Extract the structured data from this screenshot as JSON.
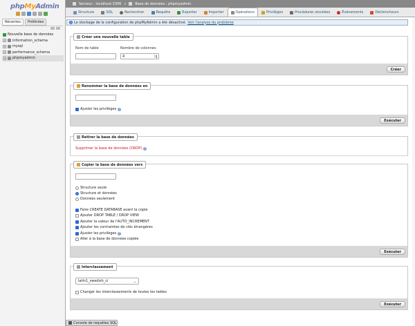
{
  "nav": {
    "logo_php": "php",
    "logo_my": "My",
    "logo_admin": "Admin",
    "tabs": [
      "Récentes",
      "Préférées"
    ],
    "tree": [
      {
        "label": "Nouvelle base de données",
        "icon": "new-db-icon"
      },
      {
        "label": "information_schema",
        "icon": "database-icon"
      },
      {
        "label": "mysql",
        "icon": "database-icon"
      },
      {
        "label": "performance_schema",
        "icon": "database-icon"
      },
      {
        "label": "phpmyadmin",
        "icon": "database-icon"
      }
    ]
  },
  "breadcrumb": {
    "server": "Serveur : localhost:3306",
    "database": "Base de données : phpmyadmin"
  },
  "tabs": [
    {
      "label": "Structure",
      "color": "#6d8fc7"
    },
    {
      "label": "SQL",
      "color": "#7b7b7b"
    },
    {
      "label": "Rechercher",
      "color": "#666"
    },
    {
      "label": "Requête",
      "color": "#4f7bb6"
    },
    {
      "label": "Exporter",
      "color": "#3c8d4e"
    },
    {
      "label": "Importer",
      "color": "#d7822b"
    },
    {
      "label": "Opérations",
      "color": "#8a8a8a"
    },
    {
      "label": "Privilèges",
      "color": "#c9a32a"
    },
    {
      "label": "Procédures stockées",
      "color": "#6c6c6c"
    },
    {
      "label": "Événements",
      "color": "#c62d2d"
    },
    {
      "label": "Déclencheurs",
      "color": "#d44a2c"
    }
  ],
  "notice": {
    "text": "Le stockage de la configuration de phpMyAdmin a été désactivé.",
    "link": "Voir l'analyse du problème"
  },
  "create_table": {
    "legend": "Créer une nouvelle table",
    "name_label": "Nom de table",
    "columns_label": "Nombre de colonnes",
    "columns_value": "4",
    "button": "Créer"
  },
  "rename_db": {
    "legend": "Renommer la base de données en",
    "privileges_label": "Ajuster les privilèges",
    "button": "Exécuter"
  },
  "drop_db": {
    "legend": "Retirer la base de données",
    "link": "Supprimer la base de données (DROP)"
  },
  "copy_db": {
    "legend": "Copier la base de données vers",
    "options": [
      {
        "label": "Structure seule",
        "checked": false
      },
      {
        "label": "Structure et données",
        "checked": true
      },
      {
        "label": "Données seulement",
        "checked": false
      }
    ],
    "checks": [
      {
        "label": "Faire CREATE DATABASE avant la copie",
        "checked": true
      },
      {
        "label": "Ajouter DROP TABLE / DROP VIEW",
        "checked": false
      },
      {
        "label": "Ajouter la valeur de l'AUTO_INCREMENT",
        "checked": true
      },
      {
        "label": "Ajouter les contraintes de clés étrangères",
        "checked": true
      },
      {
        "label": "Ajuster les privilèges",
        "checked": true
      },
      {
        "label": "Aller à la base de données copiée",
        "checked": false
      }
    ],
    "button": "Exécuter"
  },
  "collation": {
    "legend": "Interclassement",
    "selected": "latin1_swedish_ci",
    "change_all_label": "Changer les interclassements de toutes les tables",
    "button": "Exécuter"
  },
  "console": {
    "label": "Console de requêtes SQL"
  }
}
